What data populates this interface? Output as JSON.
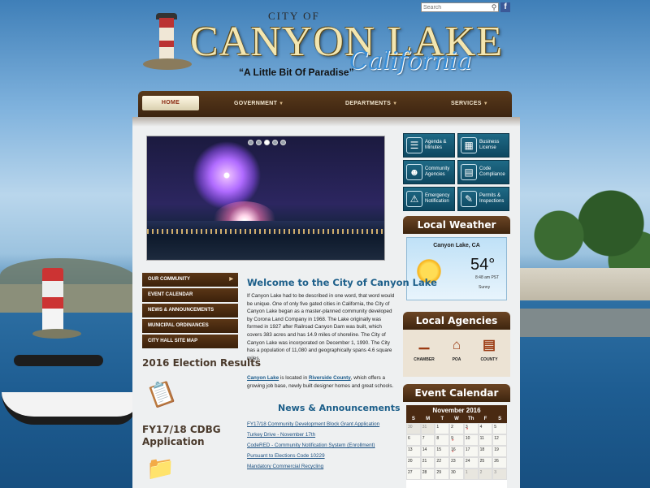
{
  "header": {
    "city_of": "CITY OF",
    "title": "CANYON LAKE",
    "state": "California",
    "tagline": "“A Little Bit Of Paradise”"
  },
  "search": {
    "placeholder": "Search"
  },
  "nav": {
    "home": "HOME",
    "government": "GOVERNMENT",
    "departments": "DEPARTMENTS",
    "services": "SERVICES"
  },
  "slideshow": {
    "dots": 5,
    "active_index": 2
  },
  "quick_links": [
    {
      "label1": "Agenda &",
      "label2": "Minutes",
      "icon": "clipboard-icon"
    },
    {
      "label1": "Business",
      "label2": "License",
      "icon": "certificate-icon"
    },
    {
      "label1": "Community",
      "label2": "Agencies",
      "icon": "people-icon"
    },
    {
      "label1": "Code",
      "label2": "Compliance",
      "icon": "book-icon"
    },
    {
      "label1": "Emergency",
      "label2": "Notification",
      "icon": "warning-icon"
    },
    {
      "label1": "Permits &",
      "label2": "Inspections",
      "icon": "permit-icon"
    }
  ],
  "weather": {
    "title": "Local Weather",
    "city": "Canyon Lake, CA",
    "temp": "54°",
    "time": "8:48 am PST",
    "condition": "Sunny"
  },
  "agencies": {
    "title": "Local Agencies",
    "items": [
      "CHAMBER",
      "POA",
      "COUNTY"
    ]
  },
  "calendar": {
    "title": "Event Calendar",
    "month": "November 2016",
    "days": [
      "S",
      "M",
      "T",
      "W",
      "Th",
      "F",
      "S"
    ],
    "cells": [
      "30",
      "31",
      "1",
      "2",
      "3",
      "4",
      "5",
      "6",
      "7",
      "8",
      "9",
      "10",
      "11",
      "12",
      "13",
      "14",
      "15",
      "16",
      "17",
      "18",
      "19",
      "20",
      "21",
      "22",
      "23",
      "24",
      "25",
      "26",
      "27",
      "28",
      "29",
      "30",
      "1",
      "2",
      "3"
    ]
  },
  "sidemenu": [
    "OUR COMMUNITY",
    "EVENT CALENDAR",
    "NEWS & ANNOUNCEMENTS",
    "MUNICIPAL ORDINANCES",
    "CITY HALL SITE MAP"
  ],
  "sidebar": {
    "election_title": "2016 Election Results",
    "cdbg_title_1": "FY17/18 CDBG",
    "cdbg_title_2": "Application"
  },
  "welcome": {
    "title": "Welcome to the City of Canyon Lake",
    "body": "If Canyon Lake had to be described in one word, that word would be unique.  One of only five gated cities in California, the City of Canyon Lake began as a master-planned community developed by Corona Land Company in 1968.  The Lake originally was formed in 1927 after Railroad Canyon Dam was built, which covers 383 acres and has 14.9 miles of shoreline.  The City of Canyon Lake was incorporated on December 1, 1990.  The City has a population of 11,080 and geographically spans 4.6 square miles.",
    "link1": "Canyon Lake",
    "mid1": " is located in ",
    "link2": "Riverside County",
    "tail": ", which offers a growing job base, newly built designer homes and great schools."
  },
  "news": {
    "title": "News & Announcements",
    "items": [
      "FY17/18 Community Development Block Grant Application",
      "Turkey Drive - November 17th",
      "CodeRED - Community Notification System (Enrollment)",
      "Pursuant to Elections Code 10229",
      "Mandatory Commercial Recycling"
    ]
  }
}
